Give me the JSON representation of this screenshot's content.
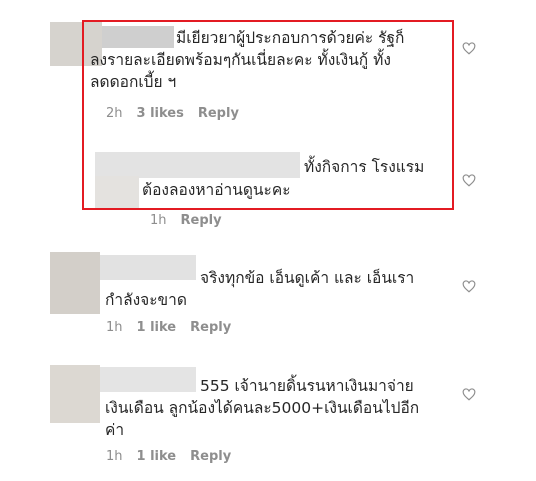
{
  "comments": [
    {
      "line1": "มีเยียวยาผู้ประกอบการด้วยค่ะ รัฐก็",
      "line2": "ลงรายละเอียดพร้อมๆกันเนี่ยละคะ ทั้งเงินกู้ ทั้ง",
      "line3": "ลดดอกเบี้ย ฯ",
      "time": "2h",
      "likes": "3 likes",
      "reply": "Reply"
    },
    {
      "line1": "ทั้งกิจการ โรงแรม",
      "line2": "ต้องลองหาอ่านดูนะคะ",
      "time": "1h",
      "reply": "Reply"
    },
    {
      "line1": "จริงทุกข้อ เอ็นดูเค้า และ เอ็นเรา",
      "line2": "กำลังจะขาด",
      "time": "1h",
      "likes": "1 like",
      "reply": "Reply"
    },
    {
      "line1": "555 เจ้านายดิ้นรนหาเงินมาจ่าย",
      "line2": "เงินเดือน ลูกน้องได้คนละ5000+เงินเดือนไปอีก",
      "line3": "ค่า",
      "time": "1h",
      "likes": "1 like",
      "reply": "Reply"
    }
  ],
  "icons": {
    "like": "heart-outline-icon"
  },
  "colors": {
    "highlight": "#e31b23",
    "meta": "#8e8e8e",
    "text": "#262626"
  }
}
